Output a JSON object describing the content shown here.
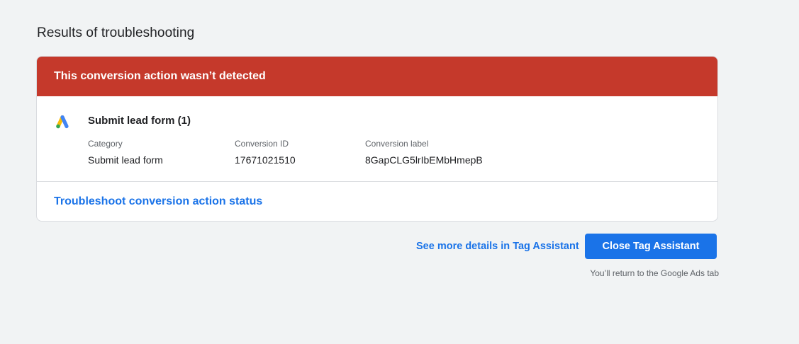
{
  "page": {
    "title": "Results of troubleshooting"
  },
  "card": {
    "banner_text": "This conversion action wasn’t detected",
    "action": {
      "icon": "google-ads-logo",
      "title": "Submit lead form (1)",
      "fields": [
        {
          "label": "Category",
          "value": "Submit lead form"
        },
        {
          "label": "Conversion ID",
          "value": "17671021510"
        },
        {
          "label": "Conversion label",
          "value": "8GapCLG5lrIbEMbHmepB"
        }
      ]
    },
    "troubleshoot_link": "Troubleshoot conversion action status"
  },
  "actions": {
    "details_link": "See more details in Tag Assistant",
    "close_button": "Close Tag Assistant",
    "return_note": "You’ll return to the Google Ads tab"
  },
  "colors": {
    "banner": "#c5392b",
    "link": "#1a73e8",
    "background": "#f1f3f4"
  }
}
